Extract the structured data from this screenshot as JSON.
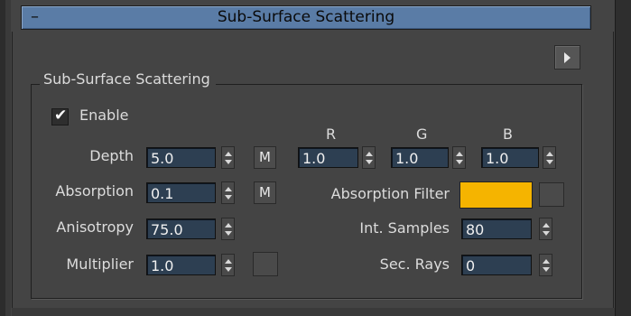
{
  "rollout": {
    "collapse_symbol": "–",
    "title": "Sub-Surface Scattering",
    "menu_icon": "triangle-right-icon"
  },
  "group": {
    "label": "Sub-Surface Scattering",
    "enable_label": "Enable",
    "enable_checked": true
  },
  "params": {
    "depth_label": "Depth",
    "depth_value": "5.0",
    "absorption_label": "Absorption",
    "absorption_value": "0.1",
    "anisotropy_label": "Anisotropy",
    "anisotropy_value": "75.0",
    "multiplier_label": "Multiplier",
    "multiplier_value": "1.0",
    "map_button_label": "M"
  },
  "rgb": {
    "r_label": "R",
    "g_label": "G",
    "b_label": "B",
    "r_value": "1.0",
    "g_value": "1.0",
    "b_value": "1.0"
  },
  "right": {
    "absorption_filter_label": "Absorption Filter",
    "absorption_filter_color": "#f5b400",
    "int_samples_label": "Int. Samples",
    "int_samples_value": "80",
    "sec_rays_label": "Sec. Rays",
    "sec_rays_value": "0"
  }
}
